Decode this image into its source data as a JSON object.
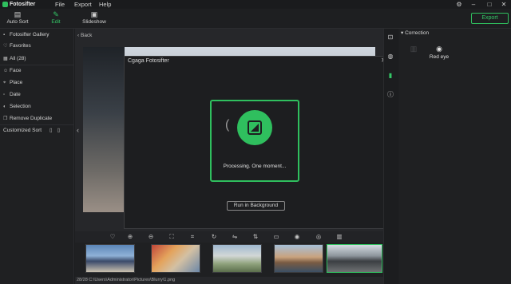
{
  "app": {
    "title": "Fotosifter"
  },
  "menu": [
    "File",
    "Export",
    "Help"
  ],
  "window_controls": {
    "settings": "⚙",
    "minimize": "–",
    "maximize": "□",
    "close": "✕"
  },
  "toolbar": {
    "tools": [
      {
        "label": "Auto Sort",
        "icon": "auto-sort-icon"
      },
      {
        "label": "Edit",
        "icon": "edit-icon",
        "active": true
      },
      {
        "label": "Slideshow",
        "icon": "slideshow-icon"
      }
    ],
    "export_label": "Export"
  },
  "sidebar": {
    "items": [
      {
        "label": "Fotosifter Gallery"
      },
      {
        "label": "Favorites"
      },
      {
        "label": "All (28)"
      },
      {
        "label": "Face"
      },
      {
        "label": "Place"
      },
      {
        "label": "Date"
      },
      {
        "label": "Selection"
      },
      {
        "label": "Remove Duplicate"
      },
      {
        "label": "Customized Sort"
      }
    ]
  },
  "main": {
    "back_label": "Back"
  },
  "dialog": {
    "title": "Cgaga Fotosifter",
    "processing_text": "Processing. One moment...",
    "background_button": "Run in Background"
  },
  "status_bar": {
    "text": "28/28  C:\\Users\\Administrator\\Pictures\\Blurry\\1.png"
  },
  "right_panel": {
    "title": "Correction",
    "items": [
      {
        "label": "",
        "icon": "blur-icon",
        "enabled": false
      },
      {
        "label": "Red eye",
        "icon": "red-eye-icon",
        "enabled": true
      }
    ]
  },
  "colors": {
    "accent": "#2fbf5e",
    "background": "#1b1c1e"
  }
}
